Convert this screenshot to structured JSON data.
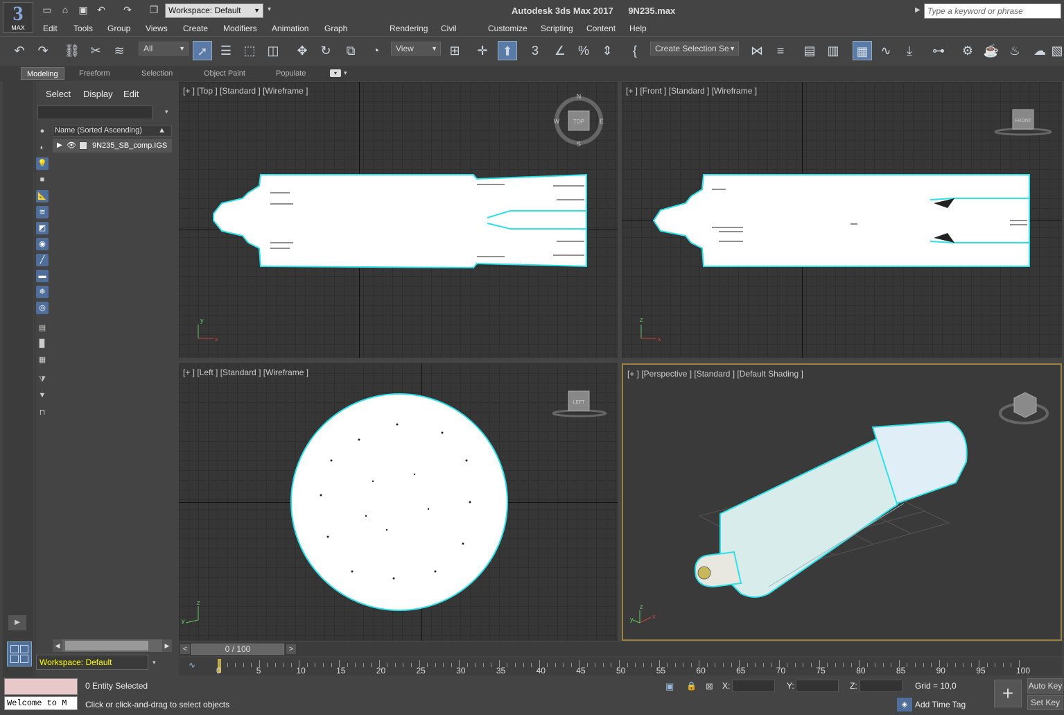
{
  "app": {
    "title": "Autodesk 3ds Max 2017",
    "file": "9N235.max",
    "logo_number": "3",
    "logo_text": "MAX",
    "workspace": "Workspace: Default",
    "search_placeholder": "Type a keyword or phrase"
  },
  "menu": [
    "Edit",
    "Tools",
    "Group",
    "Views",
    "Create",
    "Modifiers",
    "Animation",
    "Graph Editors",
    "Rendering",
    "Civil View",
    "Customize",
    "Scripting",
    "Content",
    "Help"
  ],
  "toolbar": {
    "filter": "All",
    "ref_coord": "View",
    "selection_set": "Create Selection Se"
  },
  "ribbon_tabs": [
    "Modeling",
    "Freeform",
    "Selection",
    "Object Paint",
    "Populate"
  ],
  "scene_explorer": {
    "menu": [
      "Select",
      "Display",
      "Edit"
    ],
    "column_header": "Name (Sorted Ascending)",
    "items": [
      "9N235_SB_comp.IGS"
    ]
  },
  "viewports": {
    "top": "[+ ] [Top ] [Standard ] [Wireframe ]",
    "front": "[+ ] [Front ] [Standard ] [Wireframe ]",
    "left": "[+ ] [Left ] [Standard ] [Wireframe ]",
    "perspective": "[+ ] [Perspective ] [Standard ] [Default Shading ]"
  },
  "viewcube": {
    "top_label": "TOP",
    "front_label": "FRONT",
    "left_label": "LEFT",
    "compass": {
      "n": "N",
      "s": "S",
      "e": "E",
      "w": "W"
    }
  },
  "axes": {
    "x": "x",
    "y": "y",
    "z": "z"
  },
  "timeline": {
    "frame_display": "0 / 100",
    "prev": "<",
    "next": ">",
    "ticks": [
      "0",
      "5",
      "10",
      "15",
      "20",
      "25",
      "30",
      "35",
      "40",
      "45",
      "50",
      "55",
      "60",
      "65",
      "70",
      "75",
      "80",
      "85",
      "90",
      "95",
      "100"
    ]
  },
  "status": {
    "selection": "0 Entity Selected",
    "prompt": "Click or click-and-drag to select objects",
    "maxscript": "Welcome to M",
    "x_label": "X:",
    "y_label": "Y:",
    "z_label": "Z:",
    "grid": "Grid = 10,0",
    "add_time_tag": "Add Time Tag",
    "auto_key": "Auto Key",
    "set_key": "Set Key"
  },
  "workspace_bottom": "Workspace: Default",
  "colors": {
    "accent_blue": "#5a7aa8",
    "selection_cyan": "#2ee0e8",
    "active_viewport_border": "#a08040",
    "workspace_text": "#ffff00"
  }
}
